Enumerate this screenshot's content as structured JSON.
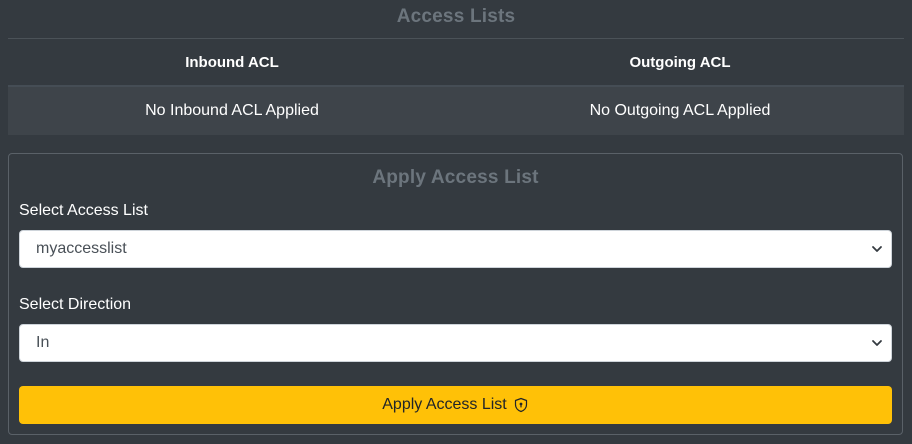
{
  "access_lists": {
    "title": "Access Lists",
    "inbound_header": "Inbound ACL",
    "outgoing_header": "Outgoing ACL",
    "inbound_value": "No Inbound ACL Applied",
    "outgoing_value": "No Outgoing ACL Applied"
  },
  "apply_form": {
    "title": "Apply Access List",
    "select_list_label": "Select Access List",
    "select_list_value": "myaccesslist",
    "select_direction_label": "Select Direction",
    "select_direction_value": "In",
    "submit_label": "Apply Access List",
    "submit_icon": "shield-lock-icon"
  },
  "colors": {
    "background": "#343a40",
    "row_background": "#3e444a",
    "muted_title": "#6c757d",
    "button": "#ffc107"
  }
}
